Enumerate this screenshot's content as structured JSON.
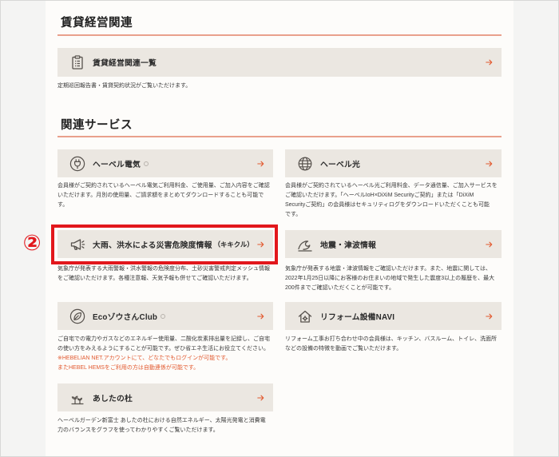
{
  "colors": {
    "accent": "#e2592f",
    "rule": "#e9a08c",
    "card_background": "#ebe7e1",
    "highlight": "#e2171c",
    "text": "#333333",
    "icon": "#57524d",
    "page_background": "#f4f4f3",
    "panel_background": "#fdfcfa"
  },
  "rental": {
    "heading": "賃貸経営関連",
    "item": {
      "label": "賃貸経営関連一覧",
      "icon": "document-icon",
      "arrow_icon": "arrow-right-icon",
      "description": "定期巡回報告書・賃貸契約状況がご覧いただけます。"
    }
  },
  "services": {
    "heading": "関連サービス",
    "items": [
      {
        "label": "ヘーベル電気",
        "icon": "plug-icon",
        "external_icon": "external-link-icon",
        "arrow_icon": "arrow-right-icon",
        "description": [
          "会員様がご契約されているヘーベル電気ご利用料金、ご使用量、ご加入内容をご確認",
          "いただけます。月別の使用量、ご請求額をまとめてダウンロードすることも可能で",
          "す。"
        ]
      },
      {
        "label": "ヘーベル光",
        "icon": "globe-icon",
        "arrow_icon": "arrow-right-icon",
        "description": [
          "会員様がご契約されているヘーベル光ご利用料金、データ通信量、ご加入サービスを",
          "ご確認いただけます。「ヘーベルIoH×DiXiM Securityご契約」または「DiXiM",
          "Securityご契約」の会員様はセキュリティログをダウンロードいただくことも可能",
          "です。"
        ]
      },
      {
        "label": "大雨、洪水による災害危険度情報",
        "label_suffix": "（キキクル）",
        "icon": "megaphone-icon",
        "arrow_icon": "arrow-right-icon",
        "highlighted": true,
        "description": [
          "気象庁が発表する大雨警報・洪水警報の危険度分布、土砂災害警戒判定メッシュ情報",
          "をご確認いただけます。各種注意報、天気予報も併せてご確認いただけます。"
        ]
      },
      {
        "label": "地震・津波情報",
        "icon": "wave-icon",
        "arrow_icon": "arrow-right-icon",
        "description": [
          "気象庁が発表する地震・津波情報をご確認いただけます。また、地震に関しては、",
          "2022年1月25日以降にお客様のお住まいの地域で発生した震度3以上の履歴を、最大",
          "200件までご確認いただくことが可能です。"
        ]
      },
      {
        "label": "EcoゾウさんClub",
        "icon": "leaf-icon",
        "external_icon": "external-link-icon",
        "arrow_icon": "arrow-right-icon",
        "description": [
          "ご自宅での電力やガスなどのエネルギー使用量、二酸化炭素排出量を記録し、ご自宅",
          "の使い方をみえるようにすることが可能です。ぜひ省エネ生活にお役立てください。"
        ],
        "note": [
          "※HEBELIAN NET.アカウントにて、どなたでもログインが可能です。",
          "またHEBEL HEMSをご利用の方は自動連係が可能です。"
        ]
      },
      {
        "label": "リフォーム設備NAVI",
        "icon": "house-icon",
        "arrow_icon": "arrow-right-icon",
        "description": [
          "リフォーム工事お打ち合わせ中の会員様は、キッチン、バスルーム、トイレ、洗面所",
          "などの設備の特徴を動画でご覧いただけます。"
        ]
      },
      {
        "label": "あしたの杜",
        "icon": "sprout-icon",
        "arrow_icon": "arrow-right-icon",
        "description": [
          "ヘーベルガーデン新富士 あしたの杜における自然エネルギー、太陽光発電と消費電",
          "力のバランスをグラフを使ってわかりやすくご覧いただけます。"
        ]
      }
    ]
  },
  "annotation": {
    "marker": "②"
  }
}
